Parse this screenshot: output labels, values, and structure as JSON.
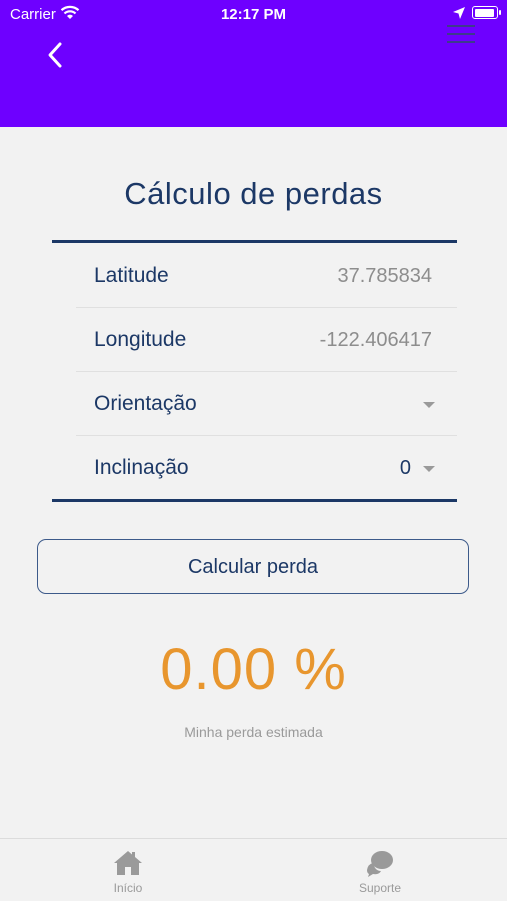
{
  "status_bar": {
    "carrier": "Carrier",
    "time": "12:17 PM"
  },
  "header": {
    "back_icon": "chevron-left-icon",
    "menu_icon": "hamburger-menu-icon",
    "background_color": "#6e00ff"
  },
  "title": "Cálculo de perdas",
  "form": {
    "latitude": {
      "label": "Latitude",
      "value": "37.785834"
    },
    "longitude": {
      "label": "Longitude",
      "value": "-122.406417"
    },
    "orientation": {
      "label": "Orientação",
      "value": ""
    },
    "inclination": {
      "label": "Inclinação",
      "value": "0"
    }
  },
  "calculate_button": "Calcular perda",
  "result": {
    "value": "0.00 %",
    "caption": "Minha perda estimada",
    "color": "#e8962e"
  },
  "tabbar": [
    {
      "label": "Início",
      "icon": "home-icon"
    },
    {
      "label": "Suporte",
      "icon": "chat-icon"
    }
  ]
}
